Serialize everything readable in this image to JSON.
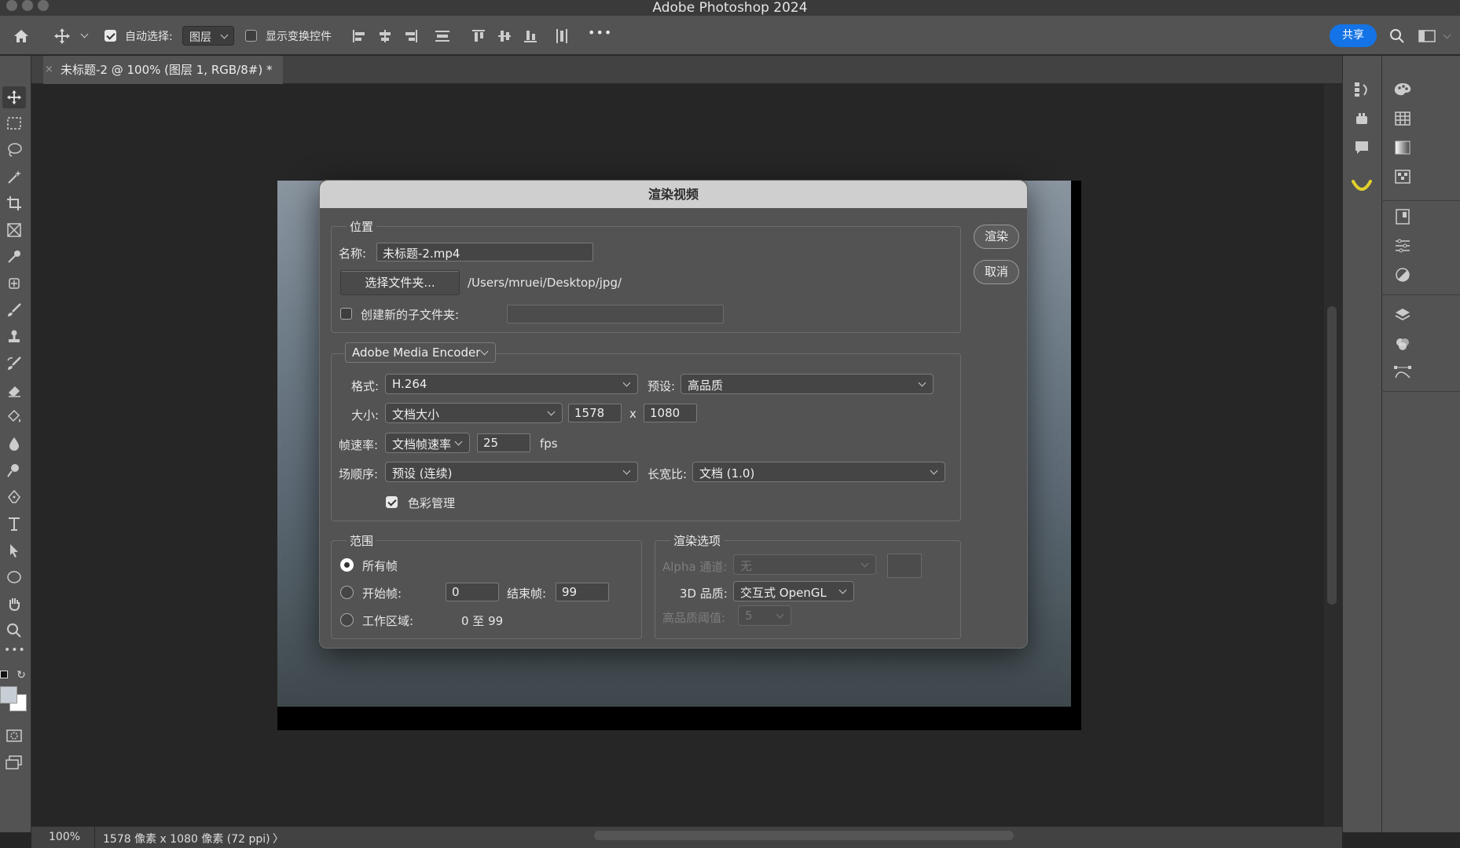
{
  "window": {
    "title": "Adobe Photoshop 2024"
  },
  "options_bar": {
    "auto_select_label": "自动选择:",
    "auto_select_checked": true,
    "auto_select_target": "图层",
    "show_transform_label": "显示变换控件",
    "show_transform_checked": false,
    "more_label": "•••",
    "share_label": "共享"
  },
  "document": {
    "tab_title": "未标题-2 @ 100% (图层 1, RGB/8#) *"
  },
  "status": {
    "zoom": "100%",
    "info": "1578 像素 x 1080 像素 (72 ppi)",
    "arrow": "〉"
  },
  "dialog": {
    "title": "渲染视频",
    "location": {
      "group_label": "位置",
      "name_label": "名称:",
      "name_value": "未标题-2.mp4",
      "choose_folder_label": "选择文件夹...",
      "path": "/Users/mruei/Desktop/jpg/",
      "subfolder_label": "创建新的子文件夹:",
      "subfolder_checked": false,
      "subfolder_value": ""
    },
    "encoder": {
      "selected": "Adobe Media Encoder",
      "format_label": "格式:",
      "format_value": "H.264",
      "preset_label": "预设:",
      "preset_value": "高品质",
      "size_label": "大小:",
      "size_value": "文档大小",
      "width": "1578",
      "x_label": "x",
      "height": "1080",
      "framerate_label": "帧速率:",
      "framerate_mode": "文档帧速率",
      "framerate_value": "25",
      "fps_label": "fps",
      "field_order_label": "场顺序:",
      "field_order_value": "预设 (连续)",
      "aspect_label": "长宽比:",
      "aspect_value": "文档 (1.0)",
      "color_mgmt_label": "色彩管理",
      "color_mgmt_checked": true
    },
    "range": {
      "group_label": "范围",
      "all_frames_label": "所有帧",
      "start_frame_label": "开始帧:",
      "start_value": "0",
      "end_frame_label": "结束帧:",
      "end_value": "99",
      "work_area_label": "工作区域:",
      "work_area_value": "0 至 99",
      "selected": "all"
    },
    "render_options": {
      "group_label": "渲染选项",
      "alpha_label": "Alpha 通道:",
      "alpha_value": "无",
      "quality3d_label": "3D 品质:",
      "quality3d_value": "交互式 OpenGL",
      "threshold_label": "高品质阈值:",
      "threshold_value": "5"
    },
    "buttons": {
      "render": "渲染",
      "cancel": "取消"
    }
  },
  "colors": {
    "accent": "#1473e6",
    "panel": "#535353",
    "canvas": "#262626"
  }
}
